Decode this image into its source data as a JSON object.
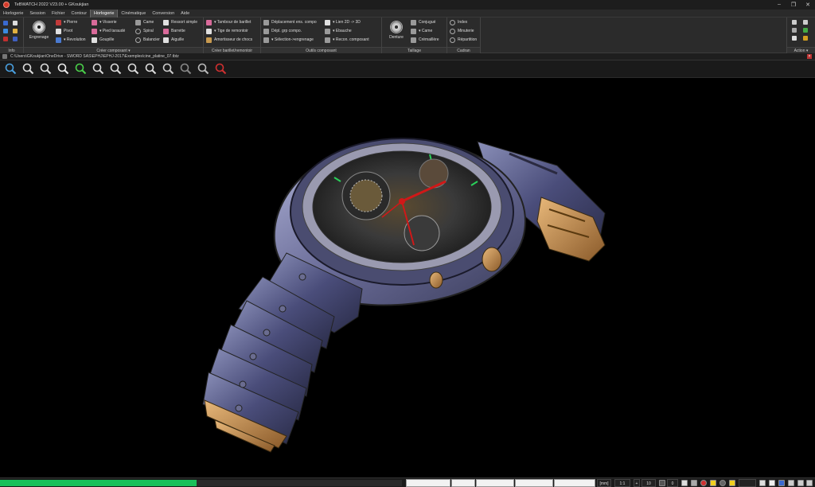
{
  "window": {
    "title": "TeBWATCH 2022 V23.00 + GKoukjian",
    "controls": [
      "–",
      "❐",
      "✕"
    ]
  },
  "menu": {
    "tabs": [
      "Horlogerie",
      "Session",
      "Fichier",
      "Contour",
      "Horlogerie",
      "Cinématique",
      "Conversion",
      "Aide"
    ],
    "active_index": 4
  },
  "ribbon": {
    "groups": {
      "info": "Info",
      "creer_composant": "Créer composant ▾",
      "creer_barillet": "Créer barillet/remontoir",
      "outils": "Outils composant",
      "taillage": "Taillage",
      "cadran": "Cadran",
      "action": "Action ▾"
    },
    "engrenage_label": "Engrenage",
    "col1": [
      "▾ Pierre",
      "Pivot",
      "▾ Revolution"
    ],
    "col2": [
      "▾ Visserie",
      "▾ Pied taraudé",
      "Goupille"
    ],
    "col3": [
      "Came",
      "Spiral",
      "Balancier"
    ],
    "col4": [
      "Ressort simple",
      "Barrette",
      "Aiguille"
    ],
    "barillet": [
      "▾ Tambour de barillet",
      "▾ Tige de remontoir",
      "Amortisseur de chocs"
    ],
    "outils1": [
      "Déplacement ens. compo",
      "Dépl. grp compo.",
      "▾ Sélection->engrenage"
    ],
    "outils2": [
      "▾ Lien 2D -> 3D",
      "▾ Ebauche",
      "▾ Recon. composant"
    ],
    "denture_label": "Denture",
    "taillage": [
      "Conjugué",
      "▾ Came",
      "Crémaillère"
    ],
    "cadran": [
      "Index",
      "Minuterie",
      "Répartition"
    ]
  },
  "path": {
    "text": "C:\\Users\\GKoukjian\\OneDrive - SWORD SAS\\EPHJ\\EPHJ-2017\\Exemples\\cine_platine_07.tbtz"
  },
  "toolbar": {
    "tools": [
      "zoom-icon",
      "zoom-window-icon",
      "zoom-pan-icon",
      "hand-pan-icon",
      "zoom-fit-icon",
      "zoom-in-icon",
      "zoom-out-icon",
      "zoom-previous-icon",
      "zoom-all-icon",
      "wireframe-cube-icon",
      "shaded-cube-icon",
      "box-cube-icon",
      "render-icon"
    ]
  },
  "status": {
    "progress_fraction": 0.49,
    "unit": "[mm]",
    "scale": "1:1",
    "plus_value": "10",
    "zero_value": "0"
  }
}
